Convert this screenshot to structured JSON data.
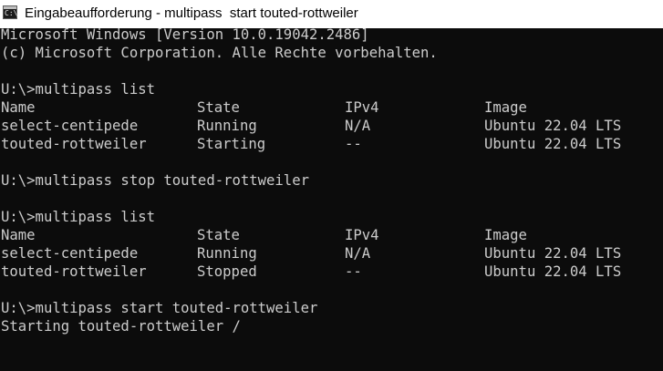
{
  "window": {
    "title": "Eingabeaufforderung - multipass  start touted-rottweiler",
    "icon": "console-icon",
    "icon_glyph": "C:\\",
    "background": "#0c0c0c",
    "foreground": "#cccccc"
  },
  "terminal": {
    "banner": [
      "Microsoft Windows [Version 10.0.19042.2486]",
      "(c) Microsoft Corporation. Alle Rechte vorbehalten."
    ],
    "blocks": [
      {
        "command": "U:\\>multipass list",
        "table": {
          "headers": [
            "Name",
            "State",
            "IPv4",
            "Image"
          ],
          "rows": [
            [
              "select-centipede",
              "Running",
              "N/A",
              "Ubuntu 22.04 LTS"
            ],
            [
              "touted-rottweiler",
              "Starting",
              "--",
              "Ubuntu 22.04 LTS"
            ]
          ]
        }
      },
      {
        "command": "U:\\>multipass stop touted-rottweiler"
      },
      {
        "command": "U:\\>multipass list",
        "table": {
          "headers": [
            "Name",
            "State",
            "IPv4",
            "Image"
          ],
          "rows": [
            [
              "select-centipede",
              "Running",
              "N/A",
              "Ubuntu 22.04 LTS"
            ],
            [
              "touted-rottweiler",
              "Stopped",
              "--",
              "Ubuntu 22.04 LTS"
            ]
          ]
        }
      },
      {
        "command": "U:\\>multipass start touted-rottweiler",
        "output": "Starting touted-rottweiler /"
      }
    ]
  }
}
